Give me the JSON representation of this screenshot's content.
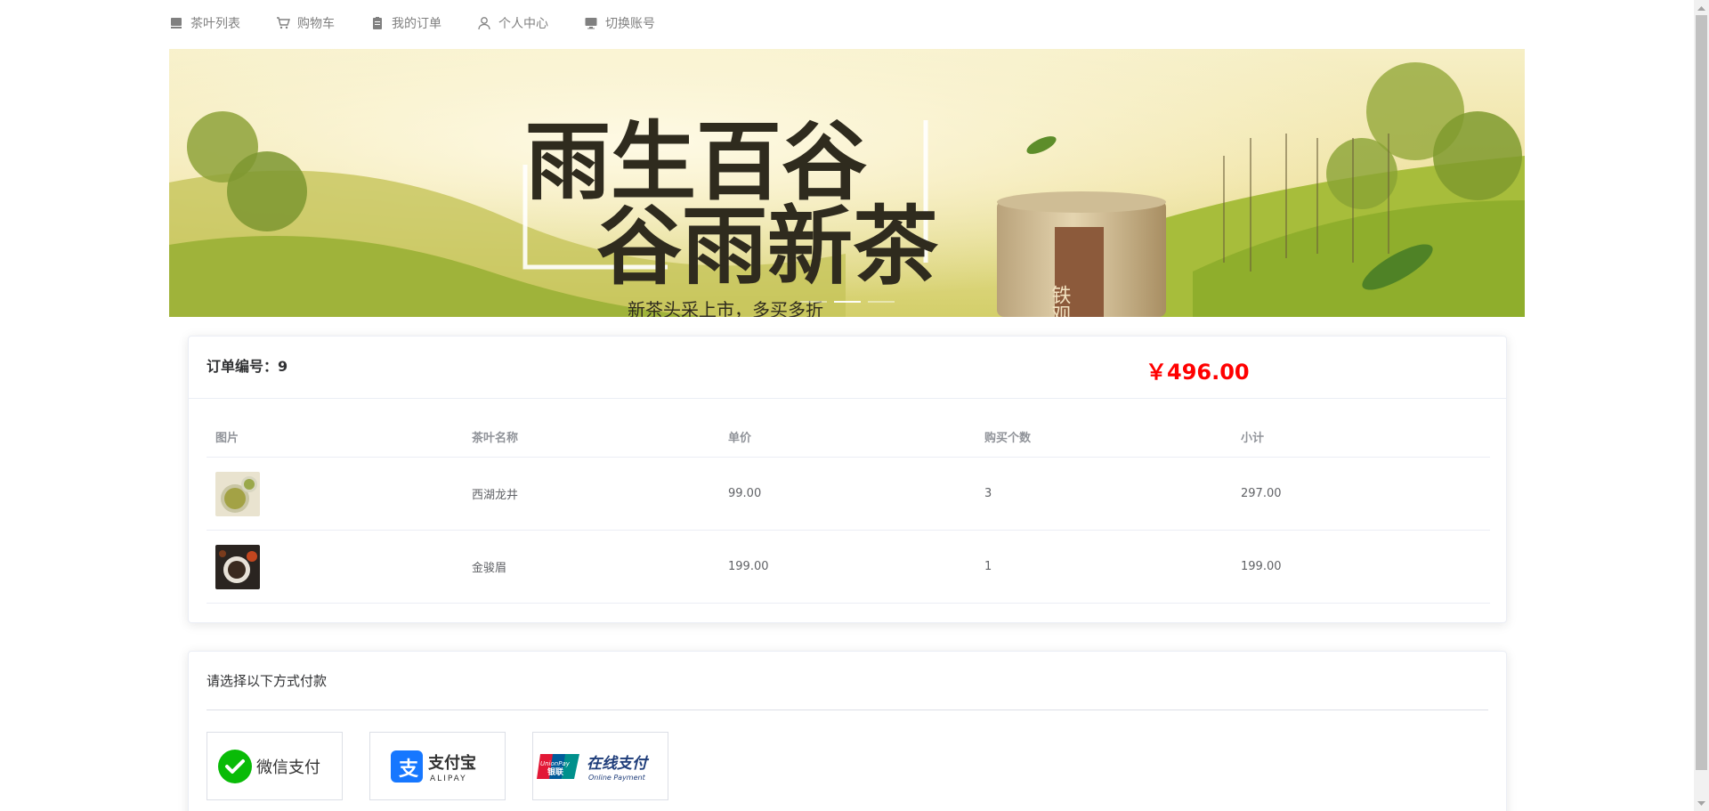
{
  "nav": {
    "items": [
      {
        "label": "茶叶列表",
        "icon": "list-icon"
      },
      {
        "label": "购物车",
        "icon": "cart-icon"
      },
      {
        "label": "我的订单",
        "icon": "clipboard-icon"
      },
      {
        "label": "个人中心",
        "icon": "user-icon"
      },
      {
        "label": "切换账号",
        "icon": "monitor-icon"
      }
    ]
  },
  "banner": {
    "title_line1": "雨生百谷",
    "title_line2": "谷雨新茶",
    "subtitle": "新茶头采上市，多买多折",
    "can_label": "铁观"
  },
  "order": {
    "number_label": "订单编号：9",
    "total": "￥496.00",
    "columns": [
      "图片",
      "茶叶名称",
      "单价",
      "购买个数",
      "小计"
    ],
    "rows": [
      {
        "name": "西湖龙井",
        "price": "99.00",
        "qty": "3",
        "subtotal": "297.00"
      },
      {
        "name": "金骏眉",
        "price": "199.00",
        "qty": "1",
        "subtotal": "199.00"
      }
    ]
  },
  "payment": {
    "title": "请选择以下方式付款",
    "options": [
      {
        "label": "微信支付"
      },
      {
        "label": "支付宝",
        "sub": "ALIPAY"
      },
      {
        "label": "在线支付",
        "sub": "Online Payment",
        "brand": "UnionPay",
        "brand_cn": "银联"
      }
    ]
  },
  "colors": {
    "accent_red": "#ff0000",
    "wechat_green": "#09bb07",
    "alipay_blue": "#1677ff",
    "unionpay_red": "#e21836",
    "unionpay_blue": "#005b9a"
  }
}
